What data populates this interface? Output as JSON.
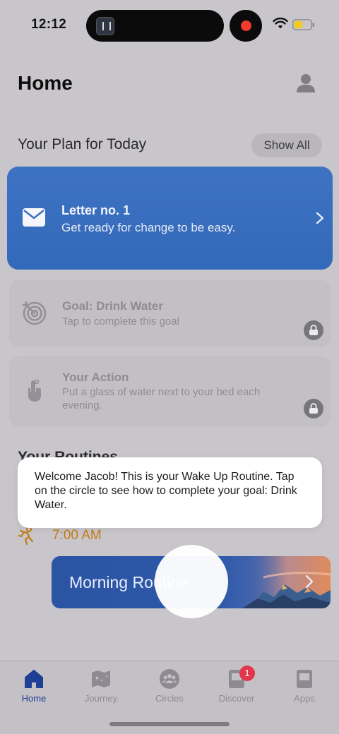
{
  "status_bar": {
    "time": "12:12"
  },
  "header": {
    "title": "Home",
    "profile_icon": "person-icon"
  },
  "plan": {
    "heading": "Your Plan for Today",
    "show_all_label": "Show All",
    "letter": {
      "title": "Letter no. 1",
      "subtitle": "Get ready for change to be easy."
    },
    "goal": {
      "title": "Goal: Drink Water",
      "subtitle": "Tap to complete this goal"
    },
    "action": {
      "title": "Your Action",
      "subtitle": "Put a glass of water next to your bed each evening."
    }
  },
  "routines": {
    "heading": "Your Routines",
    "time": "7:00 AM",
    "routine_name": "Morning Routine"
  },
  "tooltip": {
    "text": "Welcome Jacob! This is your Wake Up Routine. Tap on the circle to see how to complete your goal: Drink Water."
  },
  "tabs": [
    {
      "label": "Home",
      "active": true
    },
    {
      "label": "Journey"
    },
    {
      "label": "Circles"
    },
    {
      "label": "Discover",
      "badge": "1"
    },
    {
      "label": "Apps"
    }
  ],
  "colors": {
    "accent": "#3369b9",
    "time_orange": "#c07c16",
    "badge_red": "#e2364c",
    "active_tab": "#1e3f95"
  }
}
